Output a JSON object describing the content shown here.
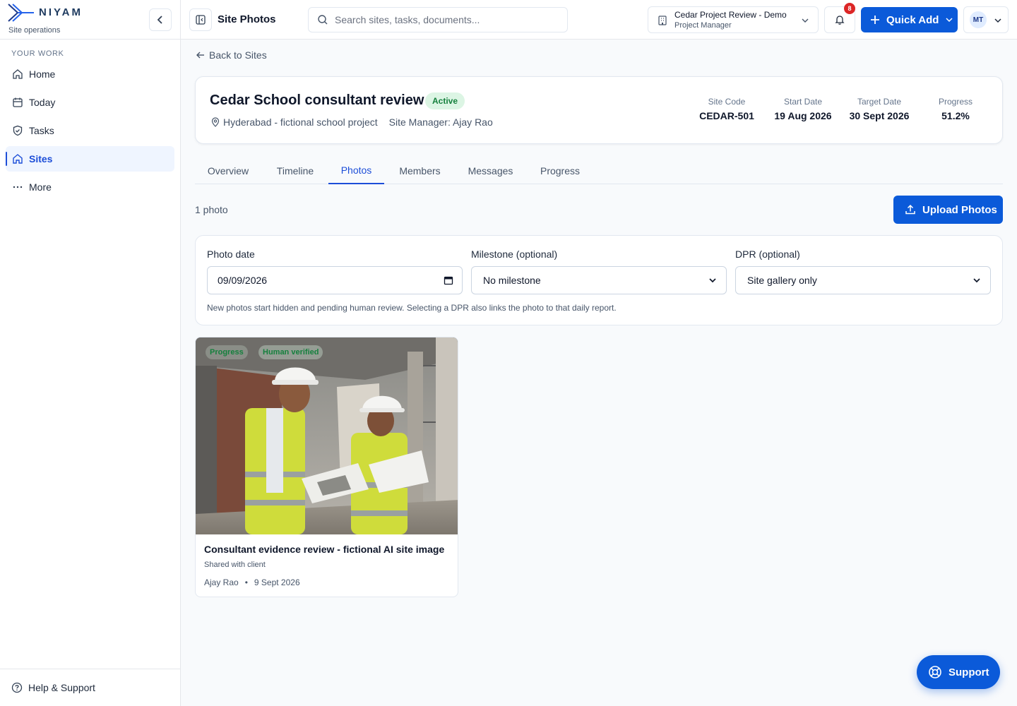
{
  "brand": {
    "name": "NIYAM",
    "subtitle": "Site operations"
  },
  "sidebar": {
    "section_label": "YOUR WORK",
    "items": [
      {
        "label": "Home",
        "icon": "home-icon"
      },
      {
        "label": "Today",
        "icon": "calendar-icon"
      },
      {
        "label": "Tasks",
        "icon": "shield-check-icon"
      },
      {
        "label": "Sites",
        "icon": "home-icon",
        "active": true
      },
      {
        "label": "More",
        "icon": "more-icon"
      }
    ],
    "footer_label": "Help & Support"
  },
  "header": {
    "title": "Site Photos",
    "search_placeholder": "Search sites, tasks, documents...",
    "project": {
      "name": "Cedar Project Review - Demo",
      "role": "Project Manager"
    },
    "notification_count": "8",
    "quick_add_label": "Quick Add",
    "user_initials": "MT"
  },
  "back_label": "Back to Sites",
  "site": {
    "title": "Cedar School consultant review",
    "status": "Active",
    "location": "Hyderabad - fictional school project",
    "manager": "Site Manager: Ajay Rao",
    "stats": [
      {
        "label": "Site Code",
        "value": "CEDAR-501"
      },
      {
        "label": "Start Date",
        "value": "19 Aug 2026"
      },
      {
        "label": "Target Date",
        "value": "30 Sept 2026"
      },
      {
        "label": "Progress",
        "value": "51.2%"
      }
    ]
  },
  "tabs": [
    "Overview",
    "Timeline",
    "Photos",
    "Members",
    "Messages",
    "Progress"
  ],
  "active_tab": "Photos",
  "photos_section": {
    "count_label": "1 photo",
    "upload_label": "Upload Photos",
    "filters": {
      "date_label": "Photo date",
      "date_value": "09/09/2026",
      "milestone_label": "Milestone (optional)",
      "milestone_value": "No milestone",
      "dpr_label": "DPR (optional)",
      "dpr_value": "Site gallery only",
      "hint": "New photos start hidden and pending human review. Selecting a DPR also links the photo to that daily report."
    },
    "items": [
      {
        "tags": [
          "Progress",
          "Human verified"
        ],
        "title": "Consultant evidence review - fictional AI site image",
        "sharing": "Shared with client",
        "author": "Ajay Rao",
        "date": "9 Sept 2026"
      }
    ]
  },
  "support_label": "Support",
  "colors": {
    "primary": "#0b5ad9",
    "active_bg": "#eff5ff",
    "success": "#15803d",
    "badge": "#dc2626"
  }
}
